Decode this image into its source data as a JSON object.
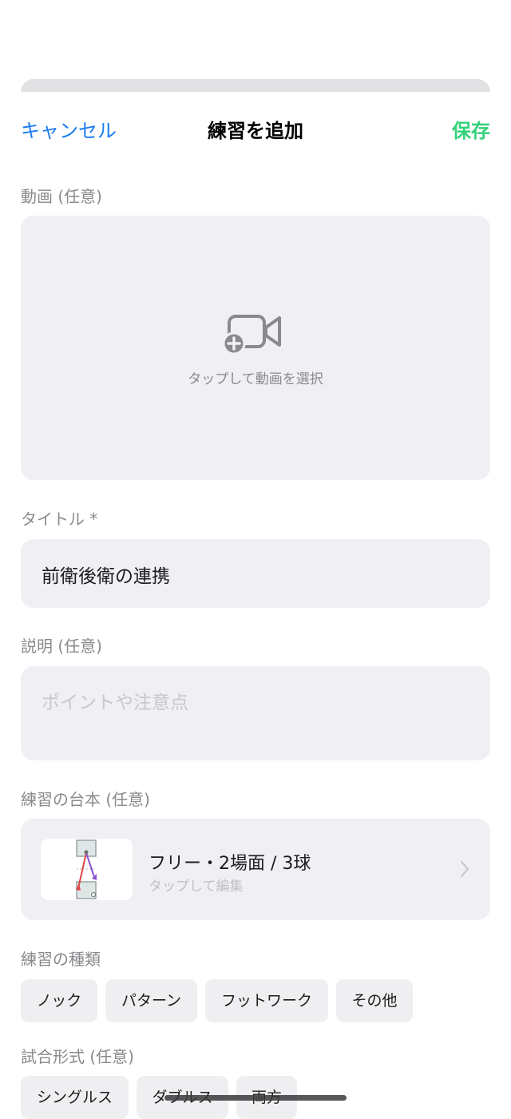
{
  "nav": {
    "cancel": "キャンセル",
    "title": "練習を追加",
    "save": "保存"
  },
  "video": {
    "label": "動画 (任意)",
    "hint": "タップして動画を選択",
    "icon": "video-plus-icon"
  },
  "title_field": {
    "label": "タイトル *",
    "value": "前衛後衛の連携"
  },
  "description": {
    "label": "説明 (任意)",
    "placeholder": "ポイントや注意点"
  },
  "script": {
    "label": "練習の台本 (任意)",
    "summary": "フリー・2場面 / 3球",
    "subtitle": "タップして編集"
  },
  "practice_type": {
    "label": "練習の種類",
    "options": [
      "ノック",
      "パターン",
      "フットワーク",
      "その他"
    ]
  },
  "match_format": {
    "label": "試合形式 (任意)",
    "options": [
      "シングルス",
      "ダブルス",
      "両方"
    ]
  },
  "colors": {
    "accent_blue": "#1a7cf0",
    "save_green": "#34d17a",
    "field_bg": "#efeff4"
  }
}
